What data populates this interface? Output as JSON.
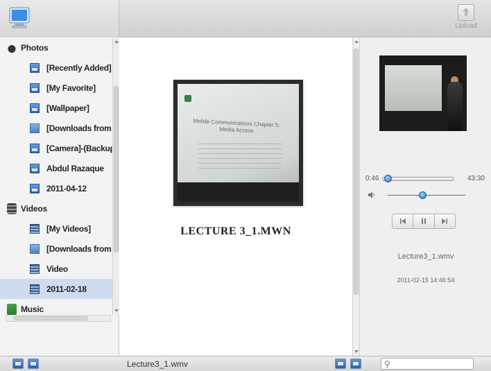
{
  "header": {
    "upload_label": "Upload"
  },
  "sidebar": {
    "groups": [
      {
        "label": "Photos",
        "items": [
          {
            "label": "[Recently Added]"
          },
          {
            "label": "[My Favorite]"
          },
          {
            "label": "[Wallpaper]"
          },
          {
            "label": "[Downloads from H"
          },
          {
            "label": "[Camera]-(Backup)"
          },
          {
            "label": "Abdul Razaque"
          },
          {
            "label": "2011-04-12"
          }
        ]
      },
      {
        "label": "Videos",
        "items": [
          {
            "label": "[My Videos]"
          },
          {
            "label": "[Downloads from H"
          },
          {
            "label": "Video"
          },
          {
            "label": "2011-02-18",
            "selected": true
          }
        ]
      },
      {
        "label": "Music",
        "items": []
      }
    ]
  },
  "center": {
    "title": "LECTURE 3_1.MWN",
    "thumbnail_text": "Mobile Communications Chapter 5: Media Access"
  },
  "player": {
    "current_time": "0:46",
    "total_time": "43:30",
    "progress_fraction": 0.018,
    "volume_fraction": 0.45,
    "file_name": "Lecture3_1.wmv",
    "file_date": "2011-02-15 14:46:54"
  },
  "statusbar": {
    "file_name": "Lecture3_1.wmv",
    "search_placeholder": ""
  }
}
